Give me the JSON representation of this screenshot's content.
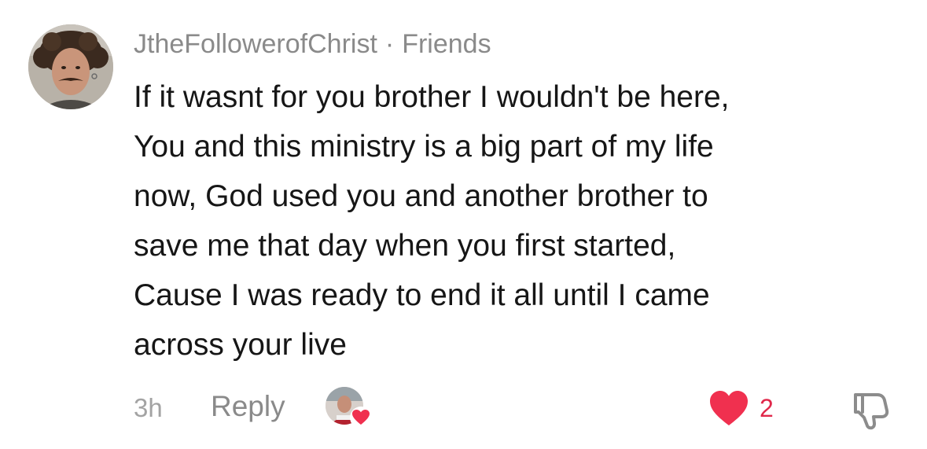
{
  "comment": {
    "username": "JtheFollowerofChrist",
    "separator": "·",
    "relationship": "Friends",
    "text_lines": [
      "If it wasnt for you brother I wouldn't be here,",
      "You and this ministry is a big part of my life",
      "now, God used you and another brother to",
      "save me that day when you first started,",
      "Cause I was ready to end it all until I came",
      "across your live"
    ],
    "time": "3h",
    "reply_label": "Reply",
    "like_count": "2",
    "creator_liked": true,
    "icons": {
      "avatar": "user-avatar",
      "creator_avatar": "creator-avatar",
      "creator_heart": "heart-icon",
      "like": "heart-icon",
      "dislike": "thumbs-down-icon"
    },
    "colors": {
      "like": "#f0304f",
      "username": "#8a8a8a",
      "text": "#161616",
      "time": "#a3a3a3"
    }
  }
}
